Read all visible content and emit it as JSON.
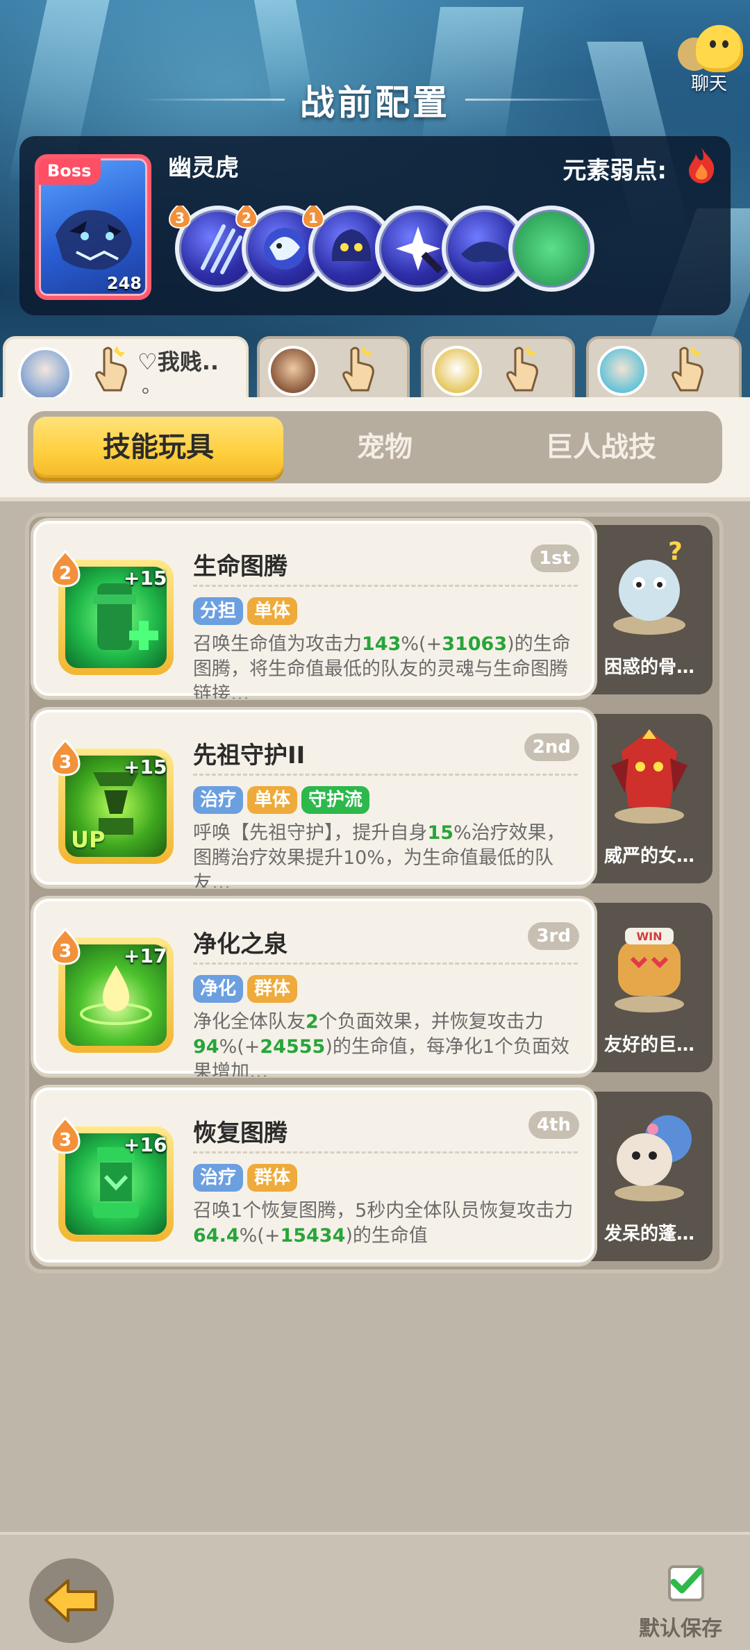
{
  "header": {
    "title": "战前配置",
    "chat_label": "聊天"
  },
  "boss": {
    "tag": "Boss",
    "level": "248",
    "name": "幽灵虎",
    "weakness_label": "元素弱点:",
    "weakness_icon": "fire-icon",
    "skills": [
      {
        "badge": "3",
        "icon": "claw-slash-icon"
      },
      {
        "badge": "2",
        "icon": "tiger-roar-icon"
      },
      {
        "badge": "1",
        "icon": "ghost-tiger-icon"
      },
      {
        "badge": "",
        "icon": "star-strike-icon"
      },
      {
        "badge": "",
        "icon": "tiger-leap-icon"
      }
    ]
  },
  "heroes": [
    {
      "note": "♡我贱..",
      "note_dot": "。",
      "active": true
    },
    {
      "note": "",
      "active": false
    },
    {
      "note": "",
      "active": false
    },
    {
      "note": "",
      "active": false
    }
  ],
  "tabs": [
    "技能玩具",
    "宠物",
    "巨人战技"
  ],
  "skills": [
    {
      "name": "生命图腾",
      "rank": "1st",
      "level": "2",
      "plus": "+15",
      "tags": [
        {
          "text": "分担",
          "color": "blue"
        },
        {
          "text": "单体",
          "color": "gold"
        }
      ],
      "desc_parts": [
        "召唤生命值为攻击力",
        "143",
        "%(+",
        "31063",
        ")的生命图腾，将生命值最低的队友的灵魂与生命图腾链接…"
      ],
      "pet_name": "困惑的骨…"
    },
    {
      "name": "先祖守护II",
      "rank": "2nd",
      "level": "3",
      "plus": "+15",
      "up": "UP",
      "tags": [
        {
          "text": "治疗",
          "color": "blue"
        },
        {
          "text": "单体",
          "color": "gold"
        },
        {
          "text": "守护流",
          "color": "green"
        }
      ],
      "desc_parts": [
        "呼唤【先祖守护】，提升自身",
        "15",
        "%治疗效果，图腾治疗效果提升10%，为生命值最低的队友…",
        "",
        ""
      ],
      "pet_name": "威严的女…"
    },
    {
      "name": "净化之泉",
      "rank": "3rd",
      "level": "3",
      "plus": "+17",
      "tags": [
        {
          "text": "净化",
          "color": "blue"
        },
        {
          "text": "群体",
          "color": "gold"
        }
      ],
      "desc_parts": [
        "净化全体队友",
        "2",
        "个负面效果，并恢复攻击力",
        "94",
        "%(+",
        "24555",
        ")的生命值，每净化1个负面效果增加…"
      ],
      "pet_name": "友好的巨…"
    },
    {
      "name": "恢复图腾",
      "rank": "4th",
      "level": "3",
      "plus": "+16",
      "tags": [
        {
          "text": "治疗",
          "color": "blue"
        },
        {
          "text": "群体",
          "color": "gold"
        }
      ],
      "desc_parts": [
        "召唤1个恢复图腾，5秒内全体队员恢复攻击力",
        "64.4",
        "%(+",
        "15434",
        ")的生命值"
      ],
      "pet_name": "发呆的蓬…"
    }
  ],
  "footer": {
    "save_label": "默认保存",
    "save_checked": true
  }
}
